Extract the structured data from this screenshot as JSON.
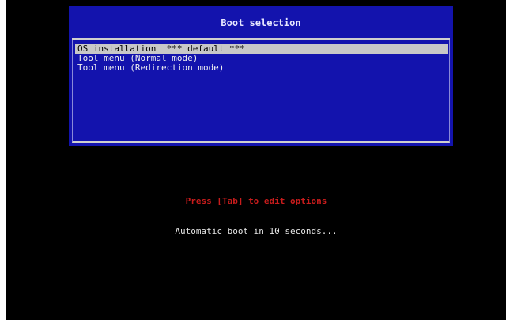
{
  "boot_menu": {
    "title": "Boot selection",
    "items": [
      {
        "label": "OS installation  *** default ***",
        "selected": true
      },
      {
        "label": "Tool menu (Normal mode)",
        "selected": false
      },
      {
        "label": "Tool menu (Redirection mode)",
        "selected": false
      }
    ]
  },
  "hint": "Press [Tab] to edit options",
  "countdown": "Automatic boot in 10 seconds...",
  "colors": {
    "panel_bg": "#1313ad",
    "selection_bg": "#c8c8c8",
    "hint_text": "#c81c1c",
    "screen_bg": "#000000"
  }
}
